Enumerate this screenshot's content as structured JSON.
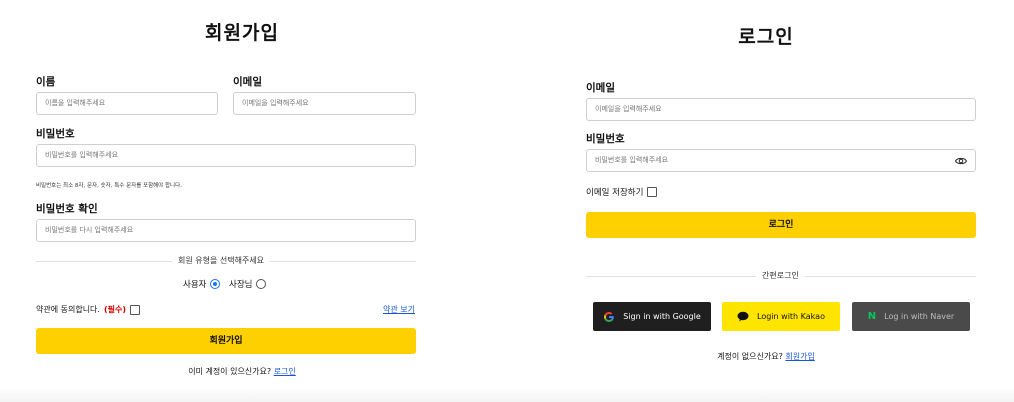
{
  "signup": {
    "title": "회원가입",
    "name_label": "이름",
    "name_placeholder": "이름을 입력해주세요",
    "email_label": "이메일",
    "email_placeholder": "이메일을 입력해주세요",
    "password_label": "비밀번호",
    "password_placeholder": "비밀번호를 입력해주세요",
    "password_hint": "비밀번호는 최소 8자, 문자, 숫자, 특수 문자를 포함해야 합니다.",
    "confirm_label": "비밀번호 확인",
    "confirm_placeholder": "비밀번호를 다시 입력해주세요",
    "user_type_prompt": "회원 유형을 선택해주세요",
    "user_types": [
      {
        "label": "사용자",
        "checked": true
      },
      {
        "label": "사장님",
        "checked": false
      }
    ],
    "terms_text": "약관에 동의합니다.",
    "terms_required": "(필수)",
    "terms_link": "약관 보기",
    "submit_label": "회원가입",
    "footer_text": "이미 계정이 있으신가요?",
    "footer_link": "로그인"
  },
  "login": {
    "title": "로그인",
    "email_label": "이메일",
    "email_placeholder": "이메일을 입력해주세요",
    "password_label": "비밀번호",
    "password_placeholder": "비밀번호를 입력해주세요",
    "save_email_label": "이메일 저장하기",
    "submit_label": "로그인",
    "easy_login_label": "간편로그인",
    "google_label": "Sign in with Google",
    "kakao_label": "Login with Kakao",
    "naver_label": "Log in with Naver",
    "footer_text": "계정이 없으신가요?",
    "footer_link": "회원가입"
  },
  "colors": {
    "accent_yellow": "#ffd000",
    "kakao_yellow": "#fde500",
    "link_blue": "#1a56db",
    "required_red": "#d10000"
  }
}
